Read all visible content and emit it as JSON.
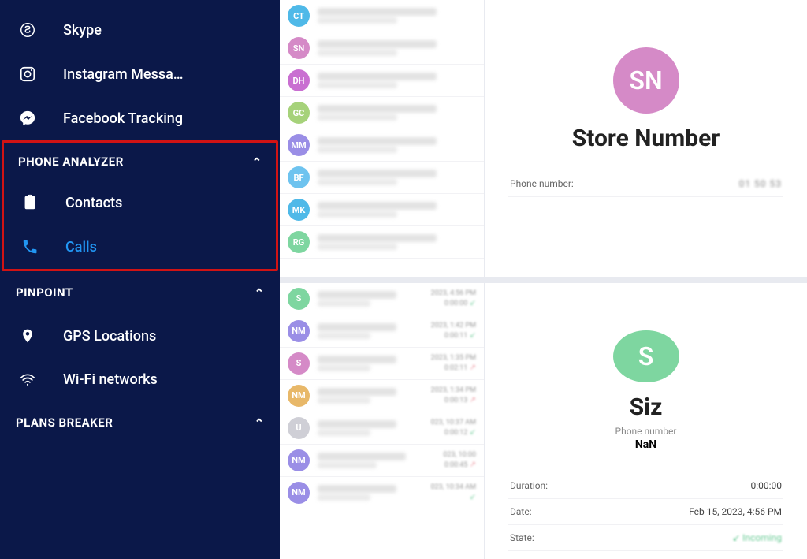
{
  "sidebar": {
    "top_items": [
      {
        "icon": "skype",
        "label": "Skype"
      },
      {
        "icon": "instagram",
        "label": "Instagram Messa…"
      },
      {
        "icon": "messenger",
        "label": "Facebook Tracking"
      }
    ],
    "sections": [
      {
        "title": "PHONE ANALYZER",
        "highlighted": true,
        "items": [
          {
            "icon": "clipboard",
            "label": "Contacts",
            "active": false
          },
          {
            "icon": "phone",
            "label": "Calls",
            "active": true
          }
        ]
      },
      {
        "title": "PINPOINT",
        "highlighted": false,
        "items": [
          {
            "icon": "pin",
            "label": "GPS Locations"
          },
          {
            "icon": "wifi",
            "label": "Wi-Fi networks"
          }
        ]
      },
      {
        "title": "PLANS BREAKER",
        "highlighted": false,
        "items": []
      }
    ]
  },
  "contacts_pane": {
    "list": [
      {
        "initials": "CT",
        "color": "#4fb9e8"
      },
      {
        "initials": "SN",
        "color": "#d58ac7"
      },
      {
        "initials": "DH",
        "color": "#c96fd1"
      },
      {
        "initials": "GC",
        "color": "#a6d27a"
      },
      {
        "initials": "MM",
        "color": "#9a8ee6"
      },
      {
        "initials": "BF",
        "color": "#6ec3ef"
      },
      {
        "initials": "MK",
        "color": "#4fb9e8"
      },
      {
        "initials": "RG",
        "color": "#7ed6a0"
      }
    ],
    "detail": {
      "avatar_initials": "SN",
      "avatar_color": "#d58ac7",
      "name": "Store Number",
      "fields": [
        {
          "k": "Phone number:",
          "v": "01 50 53",
          "blur": true
        }
      ]
    }
  },
  "calls_pane": {
    "list": [
      {
        "initials": "S",
        "color": "#7ed6a0",
        "time": "2023, 4:56 PM",
        "dur": "0:00:00",
        "dir": "in"
      },
      {
        "initials": "NM",
        "color": "#9a8ee6",
        "time": "2023, 1:42 PM",
        "dur": "0:00:11",
        "dir": "in"
      },
      {
        "initials": "S",
        "color": "#d58ac7",
        "time": "2023, 1:35 PM",
        "dur": "0:02:11",
        "dir": "out"
      },
      {
        "initials": "NM",
        "color": "#e8b869",
        "time": "2023, 1:34 PM",
        "dur": "0:00:13",
        "dir": "out"
      },
      {
        "initials": "U",
        "color": "#cfcfd6",
        "time": "023, 10:37 AM",
        "dur": "0:00:12",
        "dir": "in"
      },
      {
        "initials": "NM",
        "color": "#9a8ee6",
        "time": "023, 10:00",
        "dur": "0:00:45",
        "dir": "out"
      },
      {
        "initials": "NM",
        "color": "#9a8ee6",
        "time": "023, 10:34 AM",
        "dur": "",
        "dir": "in"
      }
    ],
    "detail": {
      "avatar_initials": "S",
      "avatar_color": "#7ed6a0",
      "name": "Siz",
      "phone_label": "Phone number",
      "phone_value": "NaN",
      "fields": [
        {
          "k": "Duration:",
          "v": "0:00:00"
        },
        {
          "k": "Date:",
          "v": "Feb 15, 2023, 4:56 PM"
        },
        {
          "k": "State:",
          "v": "Incoming",
          "state": true
        }
      ]
    }
  }
}
